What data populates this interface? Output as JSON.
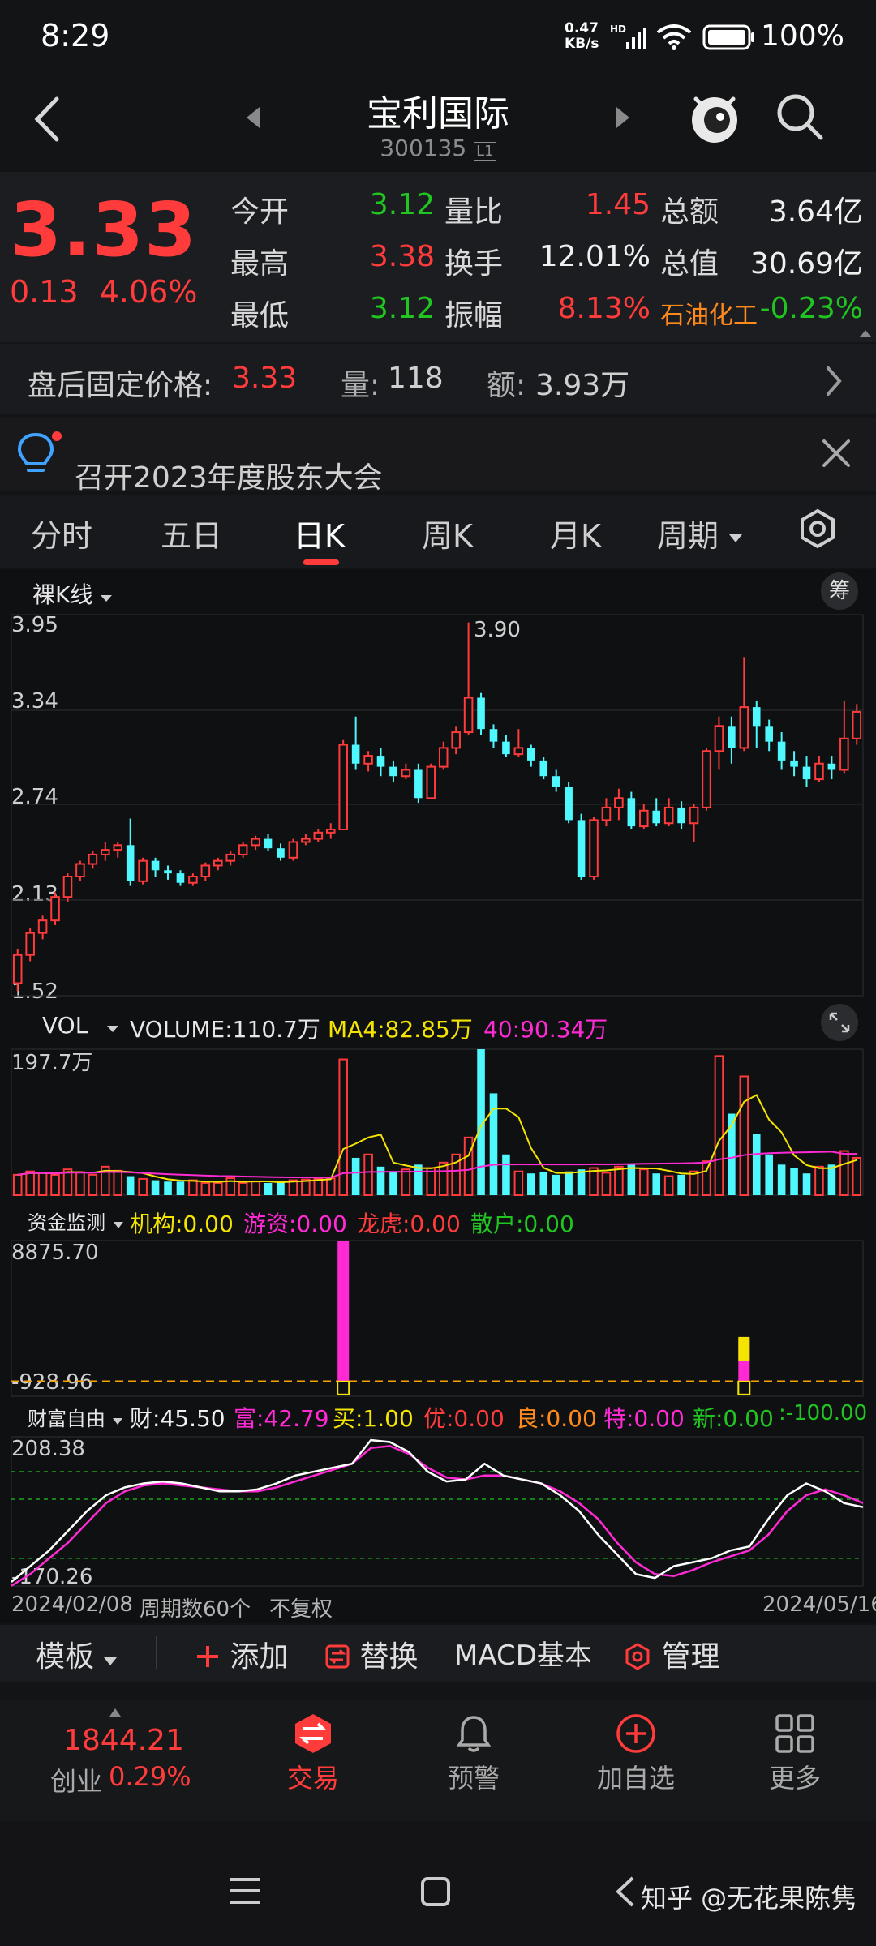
{
  "status_bar": {
    "time": "8:29",
    "net_speed_top": "0.47",
    "net_speed_unit": "KB/s",
    "battery": "100%",
    "icons": [
      "hd-icon",
      "signal-icon",
      "wifi-icon",
      "battery-icon"
    ]
  },
  "header": {
    "back_icon": "chevron-left-icon",
    "title": "宝利国际",
    "code": "300135",
    "code_badge": "L1",
    "prev_icon": "triangle-left-icon",
    "next_icon": "triangle-right-icon",
    "mascot_icon": "mascot-icon",
    "search_icon": "search-icon"
  },
  "quote": {
    "price": "3.33",
    "change": "0.13",
    "change_pct": "4.06%",
    "rows": [
      [
        {
          "label": "今开",
          "value": "3.12",
          "color": "green"
        },
        {
          "label": "量比",
          "value": "1.45",
          "color": "red"
        },
        {
          "label": "总额",
          "value": "3.64亿",
          "color": "white"
        }
      ],
      [
        {
          "label": "最高",
          "value": "3.38",
          "color": "red"
        },
        {
          "label": "换手",
          "value": "12.01%",
          "color": "white"
        },
        {
          "label": "总值",
          "value": "30.69亿",
          "color": "white"
        }
      ],
      [
        {
          "label": "最低",
          "value": "3.12",
          "color": "green"
        },
        {
          "label": "振幅",
          "value": "8.13%",
          "color": "red"
        },
        {
          "label": "石油化工",
          "value": "-0.23%",
          "color": "green"
        }
      ]
    ]
  },
  "after_hours": {
    "label": "盘后固定价格:",
    "price": "3.33",
    "vol_label": "量:",
    "vol": "118",
    "amt_label": "额:",
    "amt": "3.93万"
  },
  "notice": {
    "text": "召开2023年度股东大会",
    "close_icon": "close-icon"
  },
  "tabs": [
    "分时",
    "五日",
    "日K",
    "周K",
    "月K",
    "周期"
  ],
  "active_tab": "日K",
  "chart_settings_icon": "hexagon-settings-icon",
  "kline": {
    "mode_label": "裸K线",
    "chip_button": "筹",
    "y_ticks": [
      "3.95",
      "3.34",
      "2.74",
      "2.13",
      "1.52"
    ],
    "peak_label": "3.90"
  },
  "volume": {
    "name": "VOL",
    "volume_label": "VOLUME:110.7万",
    "ma4_label": "MA4:82.85万",
    "ma40_label": "40:90.34万",
    "y_top": "197.7万"
  },
  "fund_monitor": {
    "name": "资金监测",
    "jigou": "机构:0.00",
    "youzi": "游资:0.00",
    "longhu": "龙虎:0.00",
    "sanhu": "散户:0.00",
    "y_top": "8875.70",
    "y_bottom": "-928.96"
  },
  "wealth": {
    "name": "财富自由",
    "cai": "财:45.50",
    "fu": "富:42.79",
    "mai": "买:1.00",
    "you": "优:0.00",
    "liang": "良:0.00",
    "te": "特:0.00",
    "xin": "新:0.00",
    "tail": ":-100.00",
    "y_top": "208.38",
    "y_bottom": "-170.26"
  },
  "chart_footer": {
    "start_date": "2024/02/08",
    "period_count": "周期数60个",
    "adjust": "不复权",
    "end_date": "2024/05/16"
  },
  "toolbar": {
    "template": "模板",
    "add": "添加",
    "replace": "替换",
    "macd": "MACD基本",
    "manage": "管理"
  },
  "bottom_nav": {
    "index_value": "1844.21",
    "index_name": "创业",
    "index_pct": "0.29%",
    "trade": "交易",
    "alert": "预警",
    "add_watch": "加自选",
    "more": "更多"
  },
  "watermark": "知乎 @无花果陈隽",
  "colors": {
    "up": "#ff3b3b",
    "down": "#4ff7ff",
    "green_text": "#21c521",
    "ma4": "#f5e400",
    "ma40": "#ff2ad4",
    "background": "#0f1012"
  },
  "chart_data": {
    "type": "candlestick",
    "y_range": [
      1.52,
      3.95
    ],
    "candles": [
      [
        1.6,
        1.78,
        1.55,
        1.82
      ],
      [
        1.78,
        1.92,
        1.74,
        1.95
      ],
      [
        1.92,
        2.0,
        1.88,
        2.03
      ],
      [
        2.0,
        2.15,
        1.97,
        2.18
      ],
      [
        2.15,
        2.28,
        2.12,
        2.3
      ],
      [
        2.28,
        2.36,
        2.25,
        2.38
      ],
      [
        2.36,
        2.42,
        2.33,
        2.44
      ],
      [
        2.42,
        2.45,
        2.38,
        2.5
      ],
      [
        2.45,
        2.48,
        2.4,
        2.5
      ],
      [
        2.48,
        2.25,
        2.22,
        2.65
      ],
      [
        2.25,
        2.38,
        2.23,
        2.4
      ],
      [
        2.38,
        2.32,
        2.28,
        2.4
      ],
      [
        2.32,
        2.3,
        2.26,
        2.35
      ],
      [
        2.3,
        2.24,
        2.22,
        2.32
      ],
      [
        2.24,
        2.28,
        2.22,
        2.3
      ],
      [
        2.28,
        2.35,
        2.25,
        2.37
      ],
      [
        2.35,
        2.38,
        2.32,
        2.4
      ],
      [
        2.38,
        2.42,
        2.35,
        2.44
      ],
      [
        2.42,
        2.48,
        2.4,
        2.5
      ],
      [
        2.48,
        2.52,
        2.45,
        2.54
      ],
      [
        2.52,
        2.46,
        2.44,
        2.55
      ],
      [
        2.46,
        2.4,
        2.38,
        2.49
      ],
      [
        2.4,
        2.5,
        2.38,
        2.52
      ],
      [
        2.5,
        2.52,
        2.48,
        2.55
      ],
      [
        2.52,
        2.56,
        2.5,
        2.58
      ],
      [
        2.56,
        2.58,
        2.52,
        2.62
      ],
      [
        2.58,
        3.12,
        2.58,
        3.15
      ],
      [
        3.12,
        3.0,
        2.96,
        3.3
      ],
      [
        3.0,
        3.05,
        2.95,
        3.08
      ],
      [
        3.05,
        2.98,
        2.92,
        3.1
      ],
      [
        2.98,
        2.92,
        2.88,
        3.02
      ],
      [
        2.92,
        2.96,
        2.9,
        3.0
      ],
      [
        2.96,
        2.78,
        2.75,
        3.0
      ],
      [
        2.78,
        2.98,
        2.78,
        3.0
      ],
      [
        2.98,
        3.1,
        2.96,
        3.14
      ],
      [
        3.1,
        3.2,
        3.06,
        3.24
      ],
      [
        3.2,
        3.42,
        3.18,
        3.9
      ],
      [
        3.42,
        3.22,
        3.18,
        3.45
      ],
      [
        3.22,
        3.14,
        3.1,
        3.25
      ],
      [
        3.14,
        3.06,
        3.04,
        3.18
      ],
      [
        3.06,
        3.1,
        3.04,
        3.22
      ],
      [
        3.1,
        3.02,
        2.98,
        3.12
      ],
      [
        3.02,
        2.92,
        2.9,
        3.04
      ],
      [
        2.92,
        2.85,
        2.82,
        2.96
      ],
      [
        2.85,
        2.64,
        2.62,
        2.88
      ],
      [
        2.64,
        2.28,
        2.26,
        2.68
      ],
      [
        2.28,
        2.64,
        2.26,
        2.66
      ],
      [
        2.64,
        2.72,
        2.6,
        2.78
      ],
      [
        2.72,
        2.78,
        2.64,
        2.84
      ],
      [
        2.78,
        2.6,
        2.58,
        2.82
      ],
      [
        2.6,
        2.7,
        2.58,
        2.74
      ],
      [
        2.7,
        2.62,
        2.6,
        2.78
      ],
      [
        2.62,
        2.72,
        2.6,
        2.78
      ],
      [
        2.72,
        2.62,
        2.58,
        2.76
      ],
      [
        2.62,
        2.72,
        2.5,
        2.74
      ],
      [
        2.72,
        3.08,
        2.7,
        3.1
      ],
      [
        3.08,
        3.24,
        2.96,
        3.3
      ],
      [
        3.24,
        3.1,
        3.0,
        3.3
      ],
      [
        3.1,
        3.36,
        3.08,
        3.68
      ],
      [
        3.36,
        3.24,
        3.1,
        3.4
      ],
      [
        3.24,
        3.14,
        3.08,
        3.28
      ],
      [
        3.14,
        3.02,
        2.96,
        3.2
      ],
      [
        3.02,
        2.98,
        2.92,
        3.08
      ],
      [
        2.98,
        2.9,
        2.85,
        3.05
      ],
      [
        2.9,
        3.0,
        2.88,
        3.05
      ],
      [
        3.0,
        2.96,
        2.9,
        3.05
      ],
      [
        2.96,
        3.16,
        2.94,
        3.4
      ],
      [
        3.16,
        3.33,
        3.12,
        3.38
      ]
    ],
    "volume": [
      30,
      35,
      33,
      30,
      38,
      34,
      30,
      42,
      36,
      28,
      24,
      22,
      20,
      20,
      22,
      18,
      18,
      25,
      18,
      20,
      18,
      20,
      22,
      23,
      24,
      25,
      200,
      55,
      60,
      42,
      35,
      38,
      45,
      40,
      48,
      60,
      85,
      215,
      150,
      60,
      35,
      32,
      34,
      30,
      35,
      38,
      40,
      33,
      42,
      45,
      38,
      32,
      28,
      30,
      35,
      50,
      205,
      120,
      175,
      90,
      60,
      45,
      40,
      32,
      42,
      45,
      65,
      55
    ],
    "fund_bars": [
      {
        "index": 26,
        "value": 8875.7
      },
      {
        "index": 58,
        "value": 2600
      }
    ],
    "wealth_white": [
      -160,
      -120,
      -80,
      -30,
      20,
      60,
      80,
      90,
      95,
      90,
      80,
      70,
      70,
      75,
      90,
      110,
      120,
      130,
      140,
      200,
      195,
      170,
      120,
      95,
      100,
      140,
      110,
      100,
      90,
      60,
      20,
      -40,
      -90,
      -140,
      -150,
      -120,
      -110,
      -100,
      -80,
      -70,
      0,
      60,
      90,
      70,
      40,
      30
    ],
    "wealth_magenta": [
      -170,
      -140,
      -100,
      -60,
      -10,
      40,
      70,
      85,
      90,
      85,
      80,
      75,
      70,
      70,
      80,
      95,
      110,
      125,
      140,
      180,
      185,
      165,
      130,
      105,
      100,
      110,
      110,
      100,
      90,
      70,
      40,
      0,
      -60,
      -110,
      -140,
      -145,
      -130,
      -110,
      -95,
      -80,
      -40,
      20,
      60,
      75,
      60,
      40
    ]
  }
}
